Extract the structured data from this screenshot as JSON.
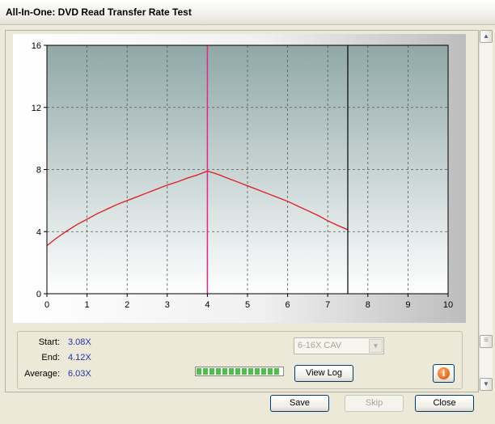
{
  "window": {
    "title": "All-In-One: DVD Read Transfer Rate Test"
  },
  "stats": {
    "start_label": "Start:",
    "start_value": "3.08X",
    "end_label": "End:",
    "end_value": "4.12X",
    "average_label": "Average:",
    "average_value": "6.03X"
  },
  "mode_select": {
    "selected": "6-16X CAV"
  },
  "progress": {
    "fraction": 1.0
  },
  "buttons": {
    "view_log": "View Log",
    "save": "Save",
    "skip": "Skip",
    "close": "Close"
  },
  "icons": {
    "info": "info-icon",
    "scroll_up": "scroll-up-icon",
    "scroll_down": "scroll-down-icon"
  },
  "colors": {
    "curve": "#e0191b",
    "marker_4gb": "#e0278e",
    "marker_end": "#000000",
    "plot_top": "#90a8a8",
    "plot_bottom": "#ffffff",
    "value_text": "#1f34a8"
  },
  "chart_data": {
    "type": "line",
    "x_ticks": [
      "0",
      "1",
      "2",
      "3",
      "4",
      "5",
      "6",
      "7",
      "8",
      "9",
      "10"
    ],
    "y_ticks": [
      "0",
      "4",
      "8",
      "12",
      "16"
    ],
    "xlim": [
      0,
      10
    ],
    "ylim": [
      0,
      16
    ],
    "grid": true,
    "series": [
      {
        "x": [
          0,
          0.25,
          0.5,
          0.75,
          1,
          1.25,
          1.5,
          1.75,
          2,
          2.25,
          2.5,
          2.75,
          3,
          3.25,
          3.5,
          3.75,
          4,
          4.25,
          4.5,
          4.75,
          5,
          5.25,
          5.5,
          5.75,
          6,
          6.25,
          6.5,
          6.75,
          7,
          7.25,
          7.5
        ],
        "y": [
          3.1,
          3.6,
          4.05,
          4.45,
          4.8,
          5.15,
          5.45,
          5.75,
          6.0,
          6.25,
          6.5,
          6.75,
          7.0,
          7.2,
          7.45,
          7.65,
          7.9,
          7.7,
          7.45,
          7.2,
          6.95,
          6.7,
          6.45,
          6.2,
          5.95,
          5.65,
          5.35,
          5.05,
          4.7,
          4.4,
          4.12
        ]
      }
    ],
    "markers": [
      {
        "x": 4.0,
        "label": ""
      },
      {
        "x": 7.5,
        "label": ""
      }
    ]
  }
}
